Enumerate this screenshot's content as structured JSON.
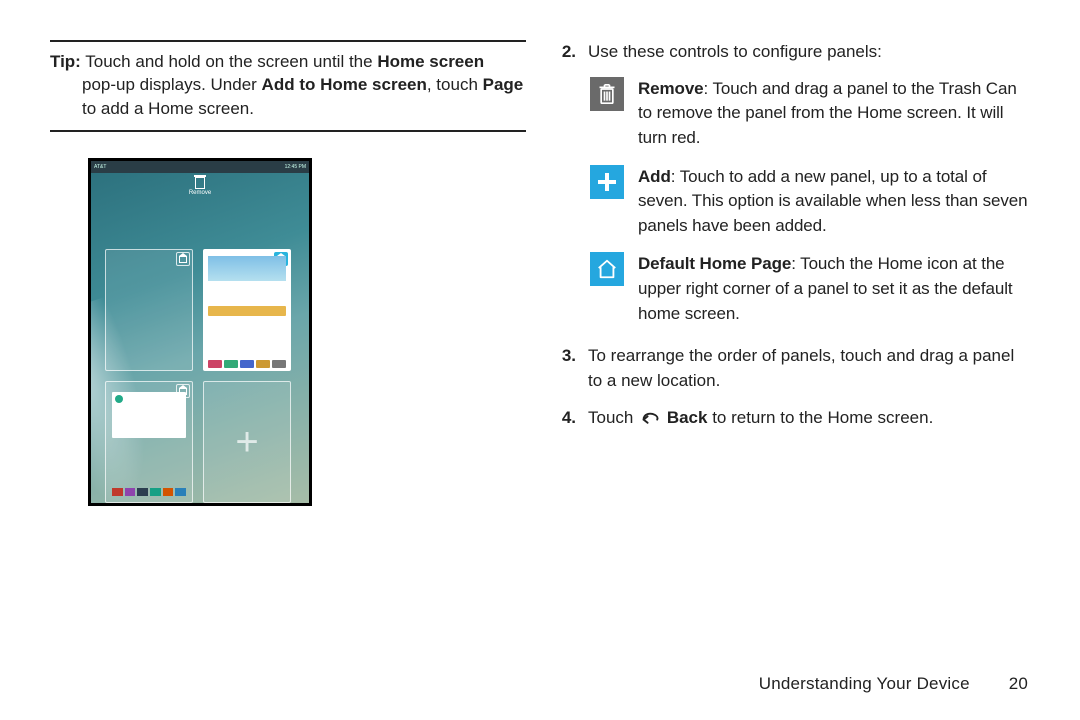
{
  "tip": {
    "label": "Tip:",
    "line1_rest": " Touch and hold on the screen until the ",
    "bold1": "Home screen",
    "line2_a": "pop-up displays. Under ",
    "bold2": "Add to Home screen",
    "line2_b": ", touch ",
    "bold3": "Page",
    "line3": "to add a Home screen."
  },
  "phone": {
    "carrier": "AT&T",
    "time": "12:45 PM",
    "remove_label": "Remove"
  },
  "right": {
    "step2": {
      "num": "2.",
      "text": "Use these controls to configure panels:"
    },
    "controls": {
      "remove": {
        "bold": "Remove",
        "rest": ": Touch and drag a panel to the Trash Can to remove the panel from the Home screen. It will turn red."
      },
      "add": {
        "bold": "Add",
        "rest": ": Touch to add a new panel, up to a total of seven. This option is available when less than seven panels have been added."
      },
      "home": {
        "bold": "Default Home Page",
        "rest": ": Touch the Home icon at the upper right corner of a panel to set it as the default home screen."
      }
    },
    "step3": {
      "num": "3.",
      "text": "To rearrange the order of panels, touch and drag a panel to a new location."
    },
    "step4": {
      "num": "4.",
      "pre": "Touch ",
      "bold": "Back",
      "post": " to return to the Home screen."
    }
  },
  "footer": {
    "section": "Understanding Your Device",
    "page": "20"
  }
}
